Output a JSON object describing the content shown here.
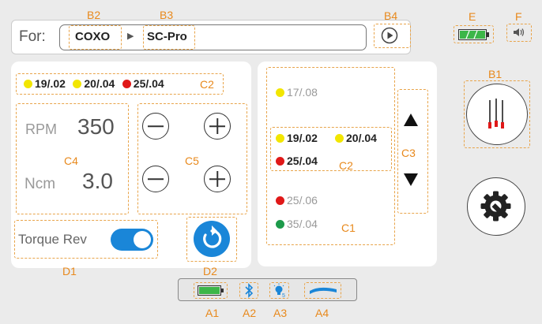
{
  "header": {
    "for_label": "For:",
    "brand": "COXO",
    "separator": "▶",
    "model": "SC-Pro"
  },
  "tags": {
    "A1": "A1",
    "A2": "A2",
    "A3": "A3",
    "A4": "A4",
    "B1": "B1",
    "B2": "B2",
    "B3": "B3",
    "B4": "B4",
    "C1": "C1",
    "C2": "C2",
    "C2b": "C2",
    "C3": "C3",
    "C4": "C4",
    "C5": "C5",
    "D1": "D1",
    "D2": "D2",
    "E": "E",
    "F": "F"
  },
  "files_top": [
    {
      "label": "19/.02",
      "color": "#f2e600"
    },
    {
      "label": "20/.04",
      "color": "#f2e600"
    },
    {
      "label": "25/.04",
      "color": "#e01818"
    }
  ],
  "settings": {
    "rpm_label": "RPM",
    "rpm_value": "350",
    "ncm_label": "Ncm",
    "ncm_value": "3.0"
  },
  "torque": {
    "label": "Torque Rev",
    "enabled": true
  },
  "sequence": {
    "top": {
      "label": "17/.08",
      "color": "#f2e600"
    },
    "current_row1": [
      {
        "label": "19/.02",
        "color": "#f2e600"
      },
      {
        "label": "20/.04",
        "color": "#f2e600"
      }
    ],
    "current_row2": {
      "label": "25/.04",
      "color": "#e01818"
    },
    "after": [
      {
        "label": "25/.06",
        "color": "#e01818"
      },
      {
        "label": "35/.04",
        "color": "#1d9a4a"
      }
    ]
  },
  "status": {
    "battery_color": "#3cb648"
  }
}
